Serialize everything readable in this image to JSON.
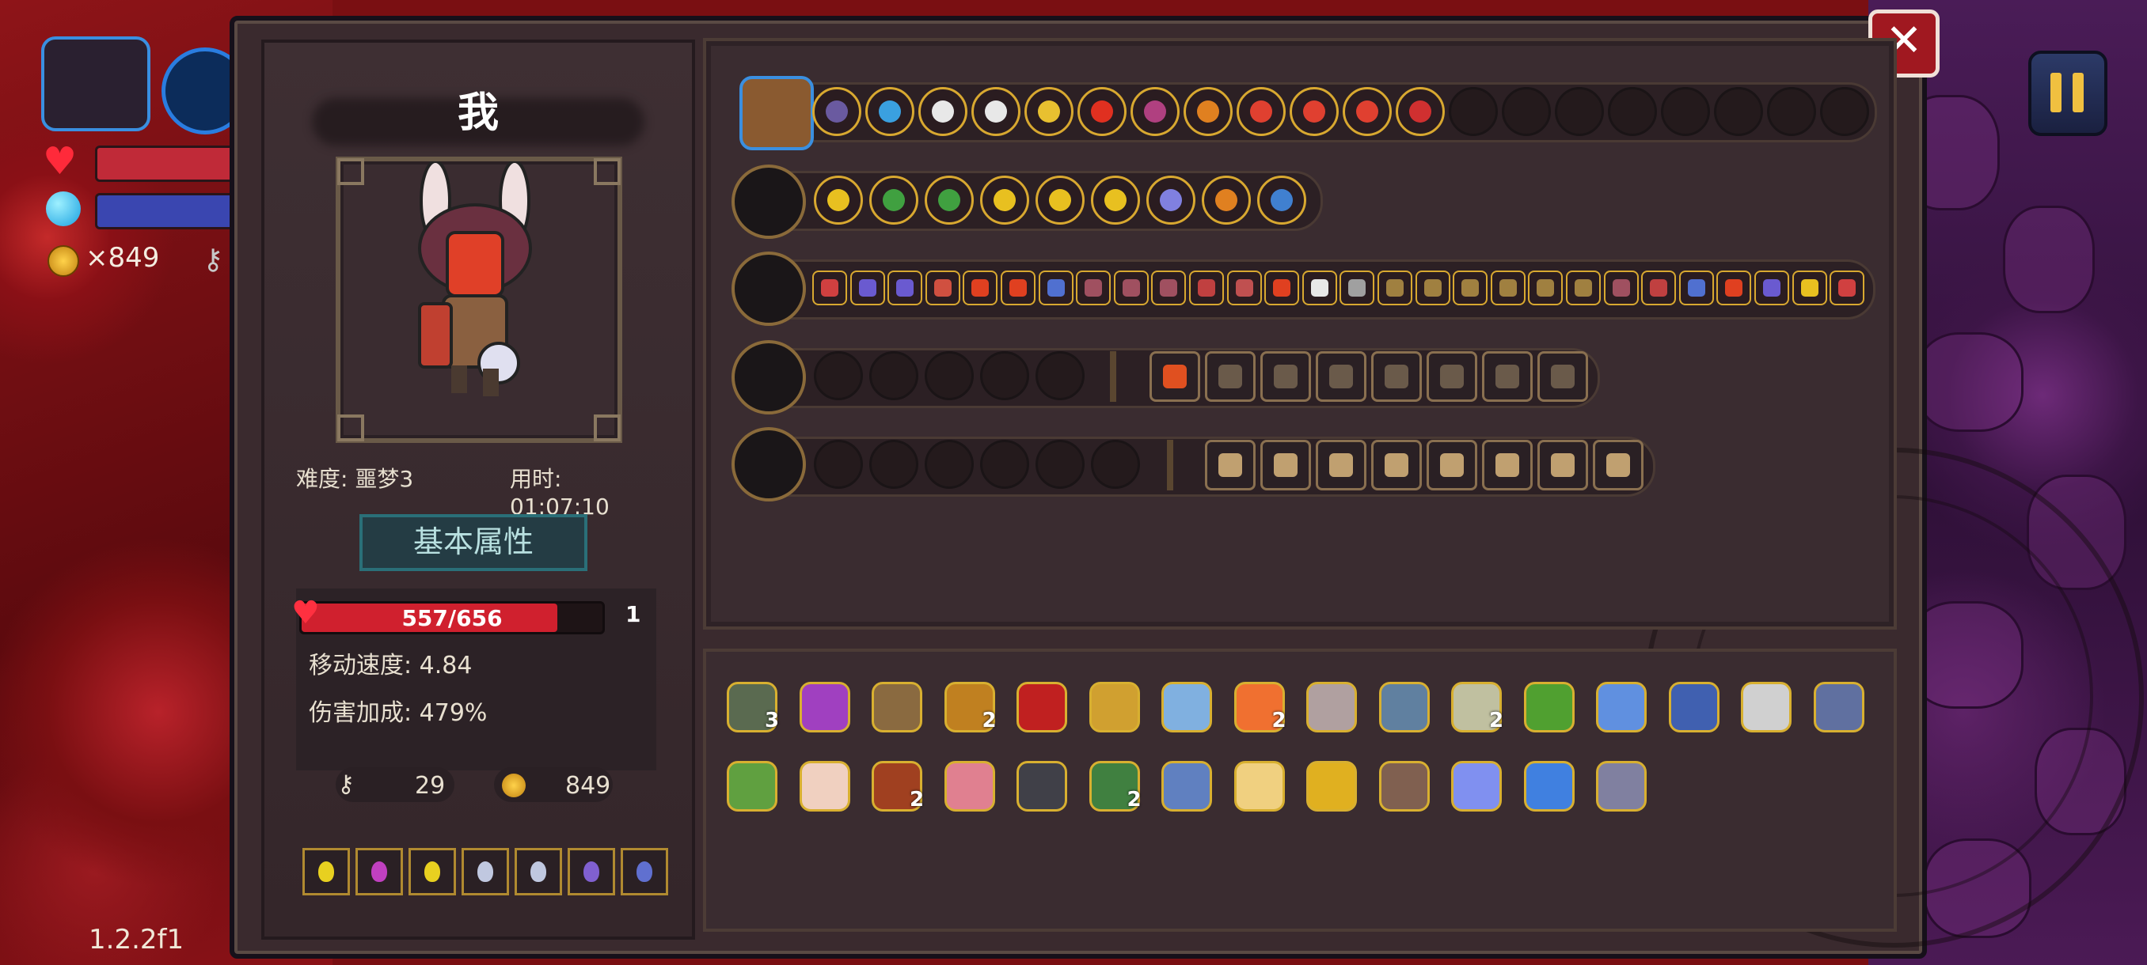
{
  "hud": {
    "coins": "×849",
    "version": "1.2.2f1"
  },
  "player": {
    "name": "我",
    "difficulty": "难度: 噩梦3",
    "time": "用时: 01:07:10",
    "section_title": "基本属性",
    "hp_text": "557/656",
    "hp_fraction": 0.849,
    "hp_level": "1",
    "move_speed": "移动速度: 4.84",
    "damage_bonus": "伤害加成: 479%",
    "keys": "29",
    "gold": "849"
  },
  "potions": [
    "#e8d020",
    "#c040c0",
    "#e8d020",
    "#c0c8e0",
    "#c0c8e0",
    "#8060d0",
    "#6070d0"
  ],
  "rows": {
    "row1_icons": [
      "#6a5aa0",
      "#3aa0e0",
      "#e8e8e8",
      "#e8e8e8",
      "#e8c030",
      "#e03020",
      "#b04080",
      "#e08020",
      "#e04030",
      "#e04030",
      "#e04030",
      "#d03030"
    ],
    "row1_empty": 8,
    "row2_icons": [
      "#e8c020",
      "#40a040",
      "#40a040",
      "#e8c020",
      "#e8c020",
      "#e8c020",
      "#8080e0",
      "#e08020",
      "#4080d0"
    ],
    "row3_icons": [
      "#d04040",
      "#6a5ad0",
      "#6a5ad0",
      "#d05040",
      "#e04020",
      "#e04020",
      "#5070d0",
      "#a05060",
      "#a05060",
      "#a05060",
      "#c04040",
      "#c05050",
      "#e04020",
      "#e8e8e8",
      "#a0a0a0",
      "#a08040",
      "#a08040",
      "#a08040",
      "#a08040",
      "#a08040",
      "#a08040",
      "#a05060",
      "#c04040",
      "#5070d0",
      "#e04020",
      "#6a5ad0",
      "#e8c020",
      "#d04040"
    ],
    "row4_empty": 5,
    "row4_sq": [
      "#e05020",
      "#6a5a4a",
      "#6a5a4a",
      "#6a5a4a",
      "#6a5a4a",
      "#6a5a4a",
      "#6a5a4a",
      "#6a5a4a"
    ],
    "row5_empty": 6,
    "row5_sq": [
      "#c0a070",
      "#c0a070",
      "#c0a070",
      "#c0a070",
      "#c0a070",
      "#c0a070",
      "#c0a070",
      "#c0a070"
    ]
  },
  "items_row1": [
    {
      "color": "#5a6a50",
      "count": "3"
    },
    {
      "color": "#a040c0",
      "count": ""
    },
    {
      "color": "#8a6a40",
      "count": ""
    },
    {
      "color": "#c08020",
      "count": "2"
    },
    {
      "color": "#c02020",
      "count": ""
    },
    {
      "color": "#d0a030",
      "count": ""
    },
    {
      "color": "#80b0e0",
      "count": ""
    },
    {
      "color": "#f07030",
      "count": "2"
    },
    {
      "color": "#b0a0a0",
      "count": ""
    },
    {
      "color": "#6080a0",
      "count": ""
    },
    {
      "color": "#c0c0a0",
      "count": "2"
    },
    {
      "color": "#50a030",
      "count": ""
    },
    {
      "color": "#6090e0",
      "count": ""
    },
    {
      "color": "#4060b0",
      "count": ""
    },
    {
      "color": "#d0d0d0",
      "count": ""
    },
    {
      "color": "#6070a0",
      "count": ""
    }
  ],
  "items_row2": [
    {
      "color": "#60a040",
      "count": ""
    },
    {
      "color": "#f0d0c0",
      "count": ""
    },
    {
      "color": "#a04020",
      "count": "2"
    },
    {
      "color": "#e08090",
      "count": ""
    },
    {
      "color": "#404048",
      "count": ""
    },
    {
      "color": "#408040",
      "count": "2"
    },
    {
      "color": "#6080c0",
      "count": ""
    },
    {
      "color": "#f0d080",
      "count": ""
    },
    {
      "color": "#e0b020",
      "count": ""
    },
    {
      "color": "#806050",
      "count": ""
    },
    {
      "color": "#8090f0",
      "count": ""
    },
    {
      "color": "#4080e0",
      "count": ""
    },
    {
      "color": "#8080a0",
      "count": ""
    }
  ]
}
